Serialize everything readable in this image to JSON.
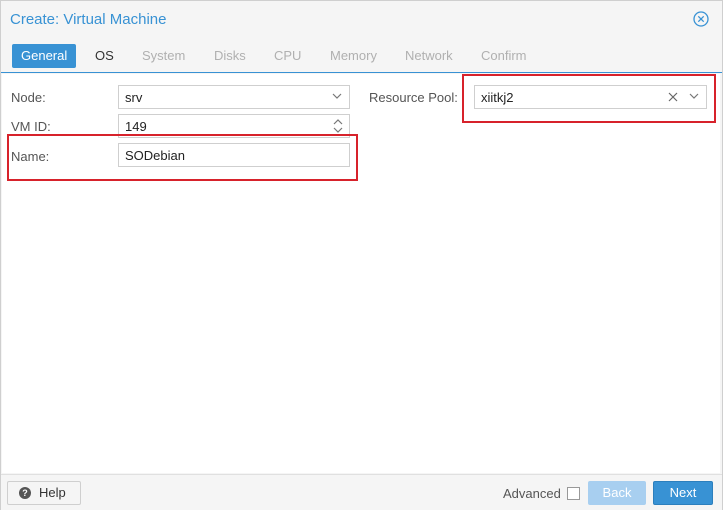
{
  "dialog": {
    "title": "Create: Virtual Machine"
  },
  "tabs": [
    {
      "label": "General",
      "state": "active"
    },
    {
      "label": "OS",
      "state": "enabled"
    },
    {
      "label": "System",
      "state": "disabled"
    },
    {
      "label": "Disks",
      "state": "disabled"
    },
    {
      "label": "CPU",
      "state": "disabled"
    },
    {
      "label": "Memory",
      "state": "disabled"
    },
    {
      "label": "Network",
      "state": "disabled"
    },
    {
      "label": "Confirm",
      "state": "disabled"
    }
  ],
  "form": {
    "node": {
      "label": "Node:",
      "value": "srv"
    },
    "vmid": {
      "label": "VM ID:",
      "value": "149"
    },
    "name": {
      "label": "Name:",
      "value": "SODebian"
    },
    "pool": {
      "label": "Resource Pool:",
      "value": "xiitkj2"
    }
  },
  "footer": {
    "help_label": "Help",
    "advanced_label": "Advanced",
    "advanced_checked": false,
    "back_label": "Back",
    "next_label": "Next"
  },
  "colors": {
    "accent": "#3892d4",
    "highlight": "#d7222b"
  },
  "icons": {
    "close": "close-circle-icon",
    "dropdown": "chevron-down-icon",
    "spinner": "spinner-arrows-icon",
    "clear": "clear-x-icon",
    "help": "question-circle-icon"
  }
}
